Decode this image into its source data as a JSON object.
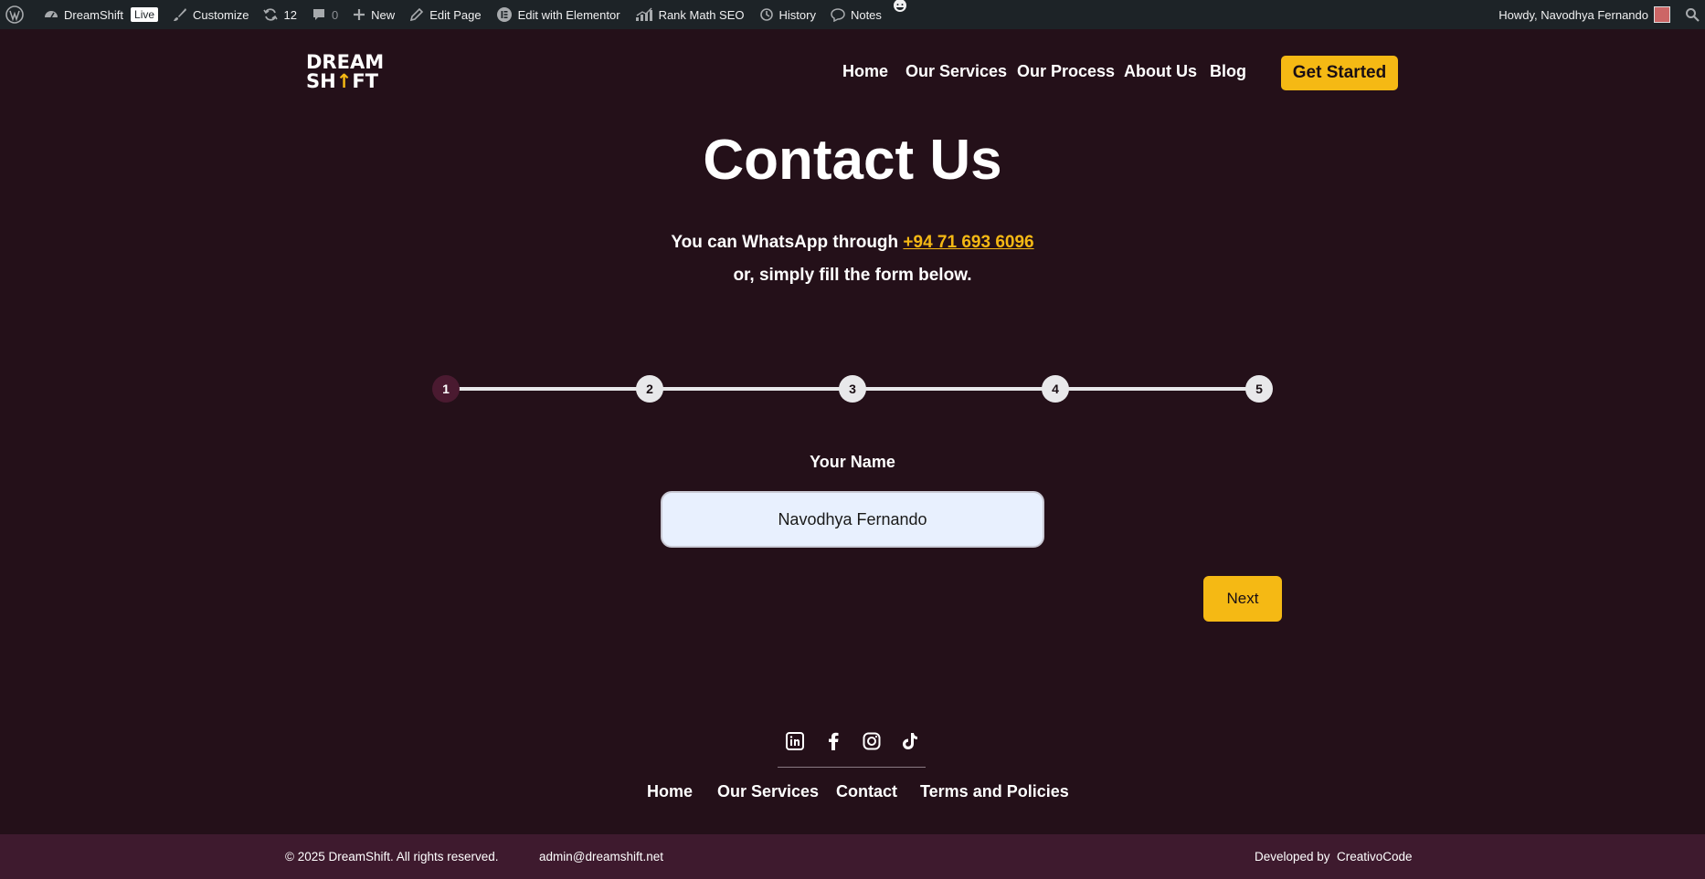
{
  "admin_bar": {
    "site_name": "DreamShift",
    "live_badge": "Live",
    "customize": "Customize",
    "updates_count": "12",
    "comments_count": "0",
    "new": "New",
    "edit_page": "Edit Page",
    "edit_elementor": "Edit with Elementor",
    "rank_math": "Rank Math SEO",
    "history": "History",
    "notes": "Notes",
    "howdy": "Howdy, Navodhya Fernando"
  },
  "header": {
    "logo_line1": "DREAM",
    "logo_line2a": "SH",
    "logo_arrow": "↑",
    "logo_line2b": "FT",
    "nav": [
      "Home",
      "Our Services",
      "Our Process",
      "About Us",
      "Blog"
    ],
    "cta": "Get Started"
  },
  "main": {
    "title": "Contact Us",
    "whatsapp_prefix": "You can WhatsApp through ",
    "whatsapp_number": "+94 71 693 6096",
    "subline": "or, simply fill the form below.",
    "steps": [
      "1",
      "2",
      "3",
      "4",
      "5"
    ],
    "active_step": 1,
    "field_label": "Your Name",
    "name_value": "Navodhya Fernando",
    "next": "Next"
  },
  "footer": {
    "social": [
      "linkedin-icon",
      "facebook-icon",
      "instagram-icon",
      "tiktok-icon"
    ],
    "links": [
      "Home",
      "Our Services",
      "Contact",
      "Terms and Policies"
    ],
    "copyright": "© 2025 DreamShift. All rights reserved.",
    "email": "admin@dreamshift.net",
    "developed_by": "Developed by",
    "developer": "CreativoCode"
  },
  "colors": {
    "background": "#241019",
    "accent": "#f5b914",
    "bottom_bar": "#3e1a2e",
    "admin_bar": "#1d2327"
  }
}
